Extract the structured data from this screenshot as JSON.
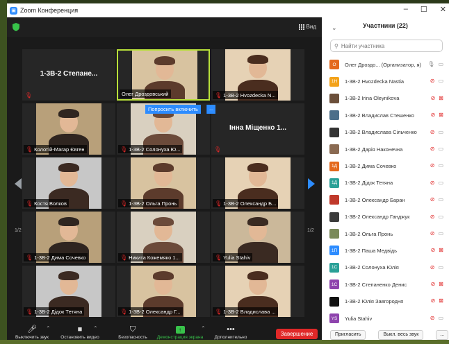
{
  "window": {
    "title": "Zoom Конференция"
  },
  "topbar": {
    "view_label": "Вид"
  },
  "tiles": [
    {
      "name": "1-3В-2 Степане...",
      "label": "",
      "kind": "name"
    },
    {
      "name": "",
      "label": "Олег Дроздовський",
      "kind": "video",
      "active": true
    },
    {
      "name": "",
      "label": "1-3В-2 Hvozdecka N...",
      "kind": "video"
    },
    {
      "name": "",
      "label": "Колотій-Магар Євген",
      "kind": "video"
    },
    {
      "name": "",
      "label": "1-3В-2 Солонуха Ю...",
      "kind": "video"
    },
    {
      "name": "Інна Міщенко 1...",
      "label": "",
      "kind": "name"
    },
    {
      "name": "",
      "label": "Костя Волков",
      "kind": "video"
    },
    {
      "name": "",
      "label": "1-3В-2 Ольга Пронь",
      "kind": "video"
    },
    {
      "name": "",
      "label": "1-3В-2 Олександр Б...",
      "kind": "video"
    },
    {
      "name": "",
      "label": "1-3В-2 Дима Сочевко",
      "kind": "video"
    },
    {
      "name": "",
      "label": "Никита Кожемяко 1...",
      "kind": "video"
    },
    {
      "name": "",
      "label": "Yulia Stahiv",
      "kind": "video"
    },
    {
      "name": "",
      "label": "1-3В-2 Дідок Тетяна",
      "kind": "video"
    },
    {
      "name": "",
      "label": "1-3В-2 Олександр Г...",
      "kind": "video"
    },
    {
      "name": "",
      "label": "1-3В-2 Владиславa ...",
      "kind": "video"
    }
  ],
  "ask_unmute": "Попросить включить",
  "ask_more": "...",
  "paging": {
    "left": "1/2",
    "right": "1/2"
  },
  "toolbar": {
    "mute": "Выключить звук",
    "stop_video": "Остановить видео",
    "security": "Безопасность",
    "share": "Демонстрация экрана",
    "more": "Дополнительно",
    "end": "Завершение"
  },
  "participants": {
    "title": "Участники (22)",
    "search_placeholder": "Найти участника",
    "items": [
      {
        "name": "Олег Дроздо... (Организатор, я)",
        "initials": "О",
        "color": "#e4691d",
        "mic": "on",
        "cam": "on"
      },
      {
        "name": "1-3В-2 Hvozdecka Nastia",
        "initials": "1H",
        "color": "#f3a21a",
        "mic": "off",
        "cam": "on"
      },
      {
        "name": "1-3В-2 Irina Oleynikova",
        "initials": "",
        "color": "#6b4f3a",
        "mic": "off",
        "cam": "off"
      },
      {
        "name": "1-3В-2 Владислав Стешенко",
        "initials": "",
        "color": "#4d6f8a",
        "mic": "off",
        "cam": "off"
      },
      {
        "name": "1-3В-2 Владислава Сільченко",
        "initials": "",
        "color": "#333333",
        "mic": "off",
        "cam": "on"
      },
      {
        "name": "1-3В-2 Дарія Наконечна",
        "initials": "",
        "color": "#8a6a52",
        "mic": "off",
        "cam": "on"
      },
      {
        "name": "1-3В-2 Дима Сочевко",
        "initials": "1Д",
        "color": "#e4691d",
        "mic": "off",
        "cam": "on"
      },
      {
        "name": "1-3В-2 Дідок Тетяна",
        "initials": "1Д",
        "color": "#2aa097",
        "mic": "off",
        "cam": "on"
      },
      {
        "name": "1-3В-2 Олександр Баран",
        "initials": "",
        "color": "#c0392b",
        "mic": "off",
        "cam": "on"
      },
      {
        "name": "1-3В-2 Олександр Ганджук",
        "initials": "",
        "color": "#3b3b3b",
        "mic": "off",
        "cam": "on"
      },
      {
        "name": "1-3В-2 Ольга Пронь",
        "initials": "",
        "color": "#7a8a5a",
        "mic": "off",
        "cam": "on"
      },
      {
        "name": "1-3В-2 Паша Медвідь",
        "initials": "1П",
        "color": "#2d8cff",
        "mic": "off",
        "cam": "off"
      },
      {
        "name": "1-3В-2 Солонуха Юлія",
        "initials": "1С",
        "color": "#2aa097",
        "mic": "off",
        "cam": "on"
      },
      {
        "name": "1-3В-2 Степаненко Денис",
        "initials": "1С",
        "color": "#8e44ad",
        "mic": "off",
        "cam": "off"
      },
      {
        "name": "1-3В-2 Юлія Завгородня",
        "initials": "",
        "color": "#111111",
        "mic": "off",
        "cam": "off"
      },
      {
        "name": "Yulia Stahiv",
        "initials": "YS",
        "color": "#8e44ad",
        "mic": "off",
        "cam": "on"
      }
    ],
    "invite": "Пригласить",
    "mute_all": "Выкл. весь звук",
    "more": "..."
  },
  "colors": {
    "zoom_blue": "#2d8cff",
    "end_red": "#e02828",
    "active_green": "#b8e03a"
  }
}
